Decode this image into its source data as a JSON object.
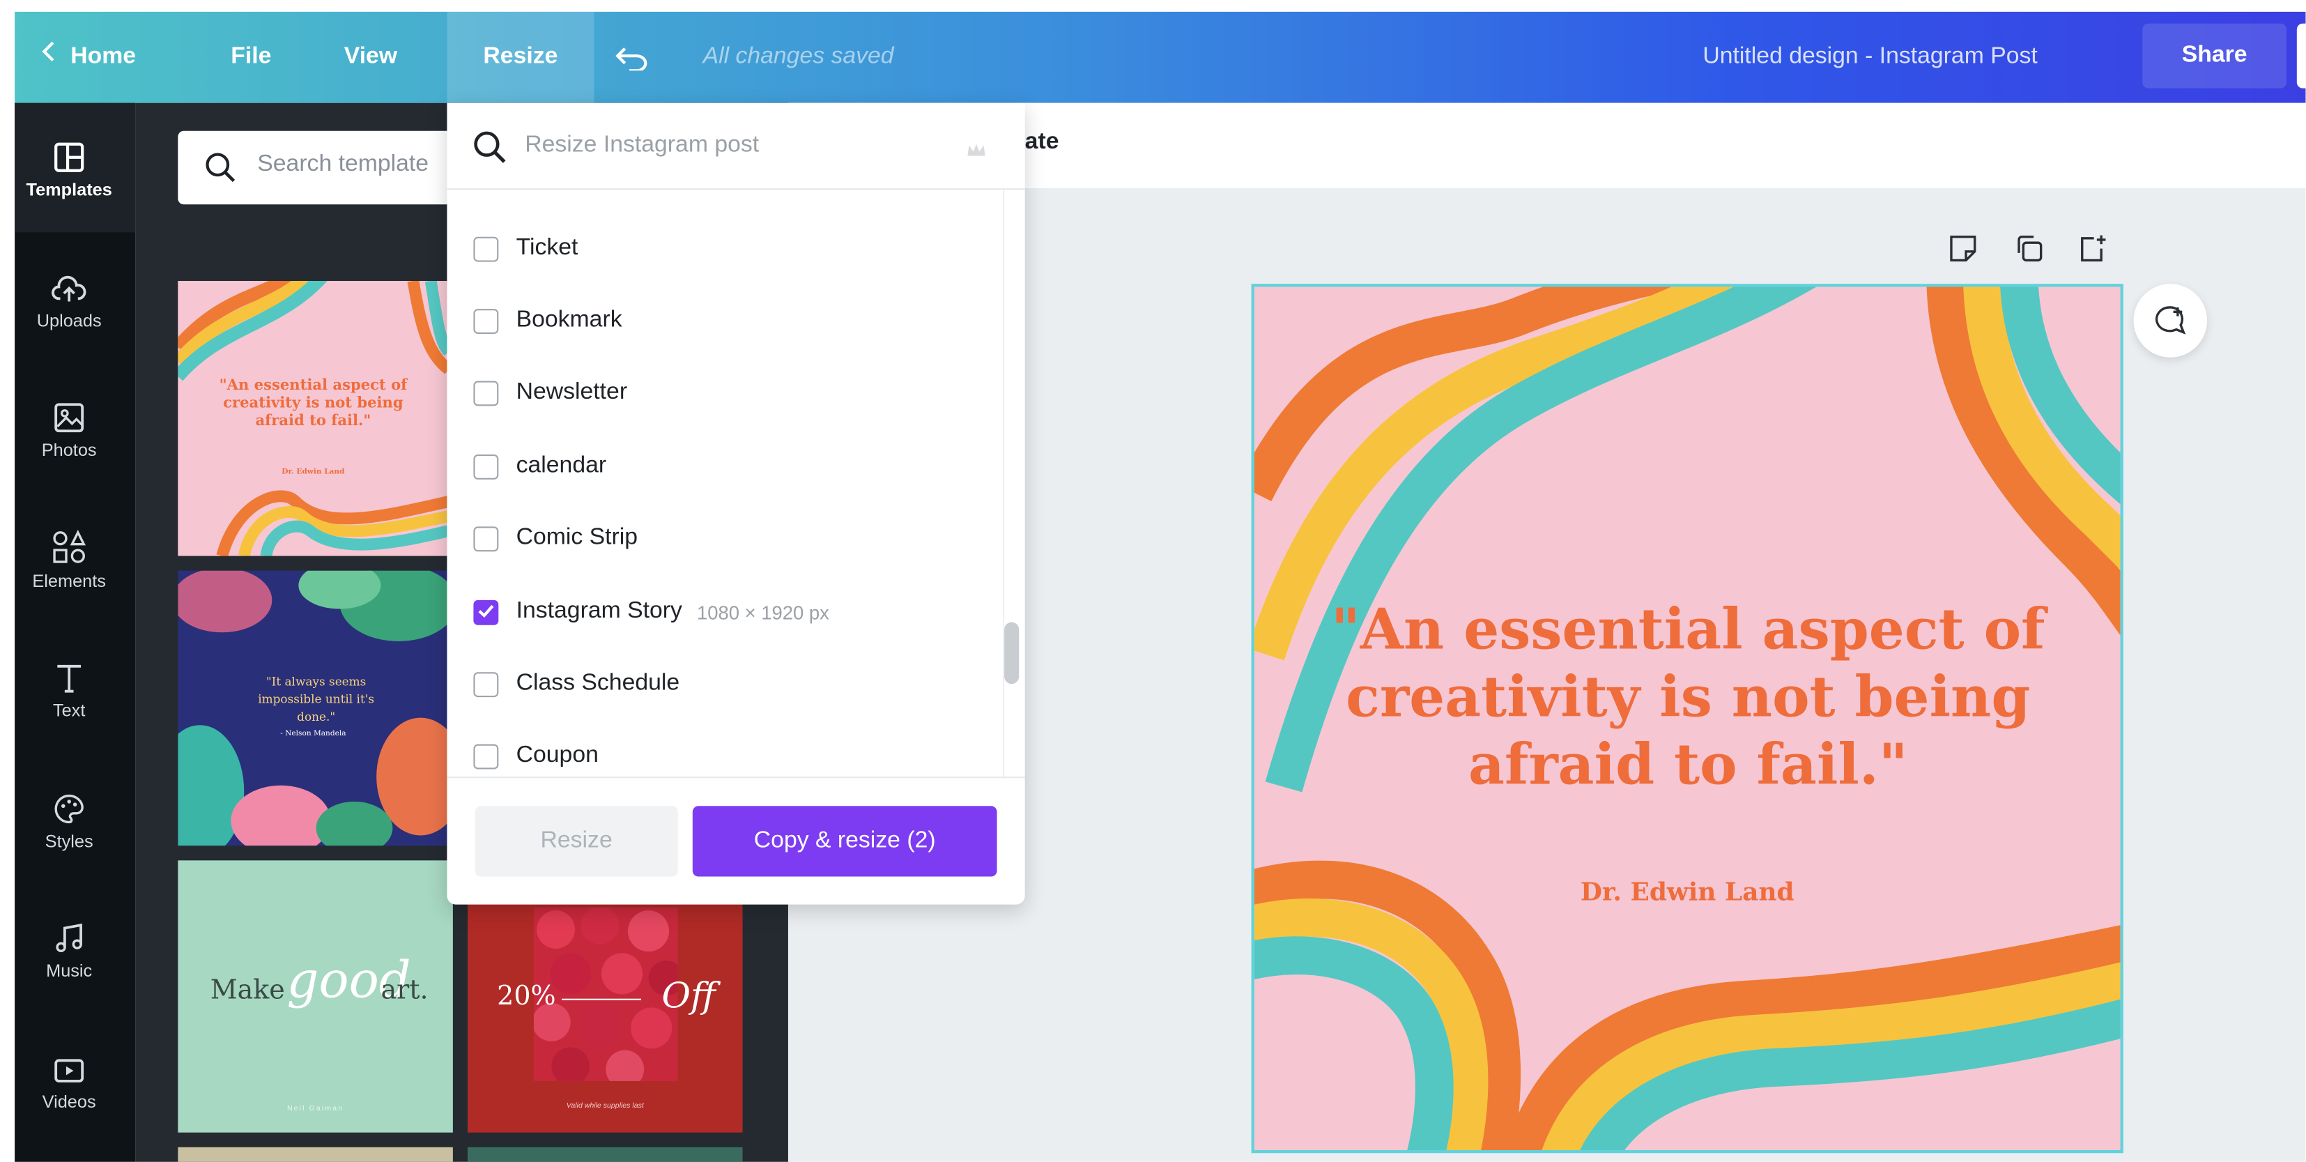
{
  "topbar": {
    "home_label": "Home",
    "file_label": "File",
    "view_label": "View",
    "resize_label": "Resize",
    "saved_status": "All changes saved",
    "design_title": "Untitled design - Instagram Post",
    "share_label": "Share"
  },
  "rail": {
    "items": [
      {
        "label": "Templates",
        "icon": "templates-icon"
      },
      {
        "label": "Uploads",
        "icon": "upload-cloud-icon"
      },
      {
        "label": "Photos",
        "icon": "photos-icon"
      },
      {
        "label": "Elements",
        "icon": "elements-icon"
      },
      {
        "label": "Text",
        "icon": "text-icon"
      },
      {
        "label": "Styles",
        "icon": "palette-icon"
      },
      {
        "label": "Music",
        "icon": "music-icon"
      },
      {
        "label": "Videos",
        "icon": "video-icon"
      }
    ]
  },
  "panel": {
    "search_placeholder": "Search template",
    "thumbs": [
      {
        "quote": "\"An essential aspect of creativity is not being afraid to fail.\"",
        "author": "Dr. Edwin Land"
      },
      {
        "quote": "\"It always seems impossible until it's done.\"",
        "author": "- Nelson Mandela"
      },
      {
        "text_left": "Make",
        "text_script": "good",
        "text_right": "art.",
        "author": "Neil Gaiman"
      },
      {
        "left": "20%",
        "right": "Off",
        "fineprint": "Valid while supplies last"
      }
    ]
  },
  "toolbar": {
    "partial_label": "ate"
  },
  "dropdown": {
    "search_placeholder": "Resize Instagram post",
    "options": [
      {
        "label": "Ticket",
        "checked": false
      },
      {
        "label": "Bookmark",
        "checked": false
      },
      {
        "label": "Newsletter",
        "checked": false
      },
      {
        "label": "calendar",
        "checked": false
      },
      {
        "label": "Comic Strip",
        "checked": false
      },
      {
        "label": "Instagram Story",
        "checked": true,
        "dimensions": "1080 × 1920 px"
      },
      {
        "label": "Class Schedule",
        "checked": false
      },
      {
        "label": "Coupon",
        "checked": false
      }
    ],
    "resize_label": "Resize",
    "copy_resize_label": "Copy & resize (2)"
  },
  "design": {
    "quote": "\"An essential aspect of creativity is not being afraid to fail.\"",
    "author": "Dr. Edwin Land",
    "colors": {
      "background": "#f6c7d3",
      "orange": "#ef7a35",
      "yellow": "#f7c33f",
      "teal": "#55c7c2",
      "text": "#ef6c3b"
    }
  },
  "colors": {
    "accent": "#7d3cf1",
    "rail_bg": "#0e1318",
    "panel_bg": "#252a31"
  }
}
